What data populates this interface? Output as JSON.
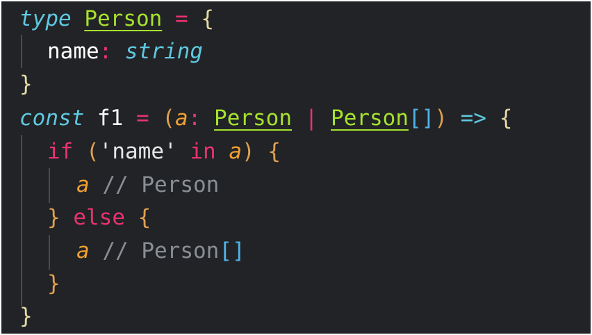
{
  "code": {
    "line1": {
      "kw": "type",
      "name": "Person",
      "eq": "=",
      "open": "{"
    },
    "line2": {
      "prop": "name",
      "colon": ":",
      "type": "string"
    },
    "line3": {
      "close": "}"
    },
    "line4": {
      "kw": "const",
      "name": "f1",
      "eq": "=",
      "lparen": "(",
      "param": "a",
      "colon": ":",
      "type1": "Person",
      "pipe": "|",
      "type2": "Person",
      "brackets": "[]",
      "rparen": ")",
      "arrow": "=>",
      "open": "{"
    },
    "line5": {
      "kw_if": "if",
      "lparen": "(",
      "str": "'name'",
      "kw_in": "in",
      "param": "a",
      "rparen": ")",
      "open": "{"
    },
    "line6": {
      "param": "a",
      "comment": "// Person"
    },
    "line7": {
      "close": "}",
      "kw_else": "else",
      "open": "{"
    },
    "line8": {
      "param": "a",
      "comment": "// Person",
      "brackets": "[]"
    },
    "line9": {
      "close": "}"
    },
    "line10": {
      "close": "}"
    }
  },
  "colors": {
    "background": "#222326",
    "keyword": "#5ec8e0",
    "operator": "#e8336e",
    "type": "#a6e22e",
    "parameter": "#f0a030",
    "comment": "#8a8f96"
  }
}
